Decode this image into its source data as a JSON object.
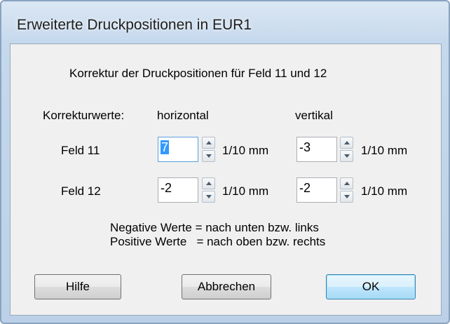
{
  "window": {
    "title": "Erweiterte Druckpositionen in EUR1"
  },
  "header": {
    "text": "Korrektur der Druckpositionen für Feld 11 und 12"
  },
  "columns": {
    "row_label": "Korrekturwerte:",
    "horizontal": "horizontal",
    "vertical": "vertikal"
  },
  "unit": "1/10 mm",
  "rows": [
    {
      "label": "Feld 11",
      "horizontal": "7",
      "vertical": "-3"
    },
    {
      "label": "Feld 12",
      "horizontal": "-2",
      "vertical": "-2"
    }
  ],
  "notes": {
    "negative": "Negative Werte = nach unten bzw. links",
    "positive": "Positive Werte   = nach oben bzw. rechts"
  },
  "buttons": {
    "help": "Hilfe",
    "cancel": "Abbrechen",
    "ok": "OK"
  },
  "icons": {
    "spin_up": "arrow-up-icon",
    "spin_down": "arrow-down-icon"
  }
}
